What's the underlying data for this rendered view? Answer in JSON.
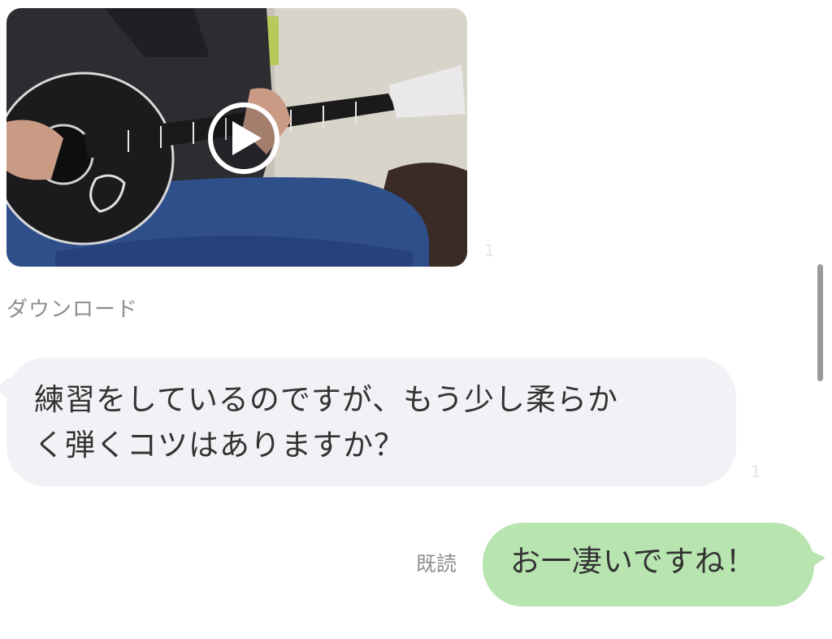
{
  "messages": {
    "video": {
      "play_icon": "play-icon",
      "time_label": "1"
    },
    "download_label": "ダウンロード",
    "incoming": {
      "line1": "練習をしているのですが、もう少し柔らか",
      "line2": "く弾くコツはありますか？",
      "time_label": "1"
    },
    "outgoing": {
      "read_status": "既読",
      "text": "お一凄いですね！"
    }
  },
  "colors": {
    "incoming_bubble": "#f1f2f5",
    "outgoing_bubble": "#b8e4b0",
    "muted_text": "#8e8e93"
  }
}
